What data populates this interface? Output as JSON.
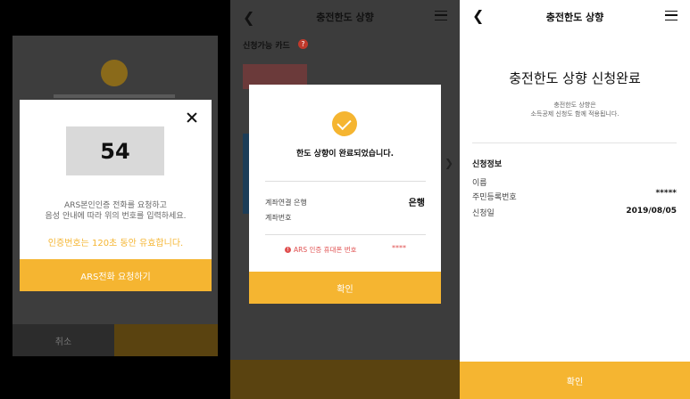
{
  "screen1": {
    "cancel_label": "취소",
    "code": "54",
    "desc_line1": "ARS본인인증 전화를 요청하고",
    "desc_line2": "음성 안내에 따라 위의 번호를 입력하세요.",
    "validity": "인증번호는 120초 동안 유효합니다.",
    "ars_button": "ARS전화 요청하기"
  },
  "screen2": {
    "title": "충전한도 상향",
    "subtitle": "신청가능 카드",
    "message": "한도 상향이 완료되었습니다.",
    "account_bank_label": "계좌연결 은행",
    "account_bank_value": "은행",
    "account_number_label": "계좌번호",
    "ars_phone_label": "ARS 인증 휴대폰 번호",
    "ars_phone_value": "****",
    "confirm_label": "확인"
  },
  "screen3": {
    "title": "충전한도 상향",
    "heading": "충전한도 상향 신청완료",
    "note_line1": "충전한도 상향은",
    "note_line2": "소득공제 신청도 함께 적용됩니다.",
    "section_title": "신청정보",
    "name_label": "이름",
    "rrn_label": "주민등록번호",
    "rrn_value": "*****",
    "date_label": "신청일",
    "date_value": "2019/08/05",
    "confirm_label": "확인"
  },
  "colors": {
    "accent": "#f5b531",
    "warning": "#e05050"
  }
}
